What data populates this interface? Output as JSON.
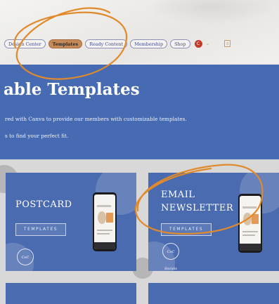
{
  "nav": {
    "items": [
      {
        "label": "Design Center",
        "visible": "Design Center",
        "active": false
      },
      {
        "label": "Templates",
        "visible": "Templates",
        "active": true
      },
      {
        "label": "Ready Content",
        "visible": "Ready Content",
        "active": false
      },
      {
        "label": "Membership",
        "visible": "Membership",
        "active": false
      },
      {
        "label": "Shop",
        "visible": "Shop",
        "active": false
      }
    ],
    "avatar_letter": "C",
    "chevron_icon": "chevron-down-icon",
    "cart_icon": "shopping-bag-icon",
    "cart_count": "0"
  },
  "hero": {
    "title": "able Templates",
    "line1": "red with Canva to provide our members with customizable templates.",
    "line2": "s to find your perfect fit."
  },
  "cards": [
    {
      "title_line1": "POSTCARD",
      "title_line2": "",
      "tag": "TEMPLATES",
      "logo": "CoC Socials"
    },
    {
      "title_line1": "EMAIL",
      "title_line2": "NEWSLETTER",
      "tag": "TEMPLATES",
      "logo": "CoC Socials"
    }
  ],
  "colors": {
    "brand_blue": "#466bb2",
    "active_tab": "#c58a58",
    "annotation_orange": "#e08a2c"
  }
}
